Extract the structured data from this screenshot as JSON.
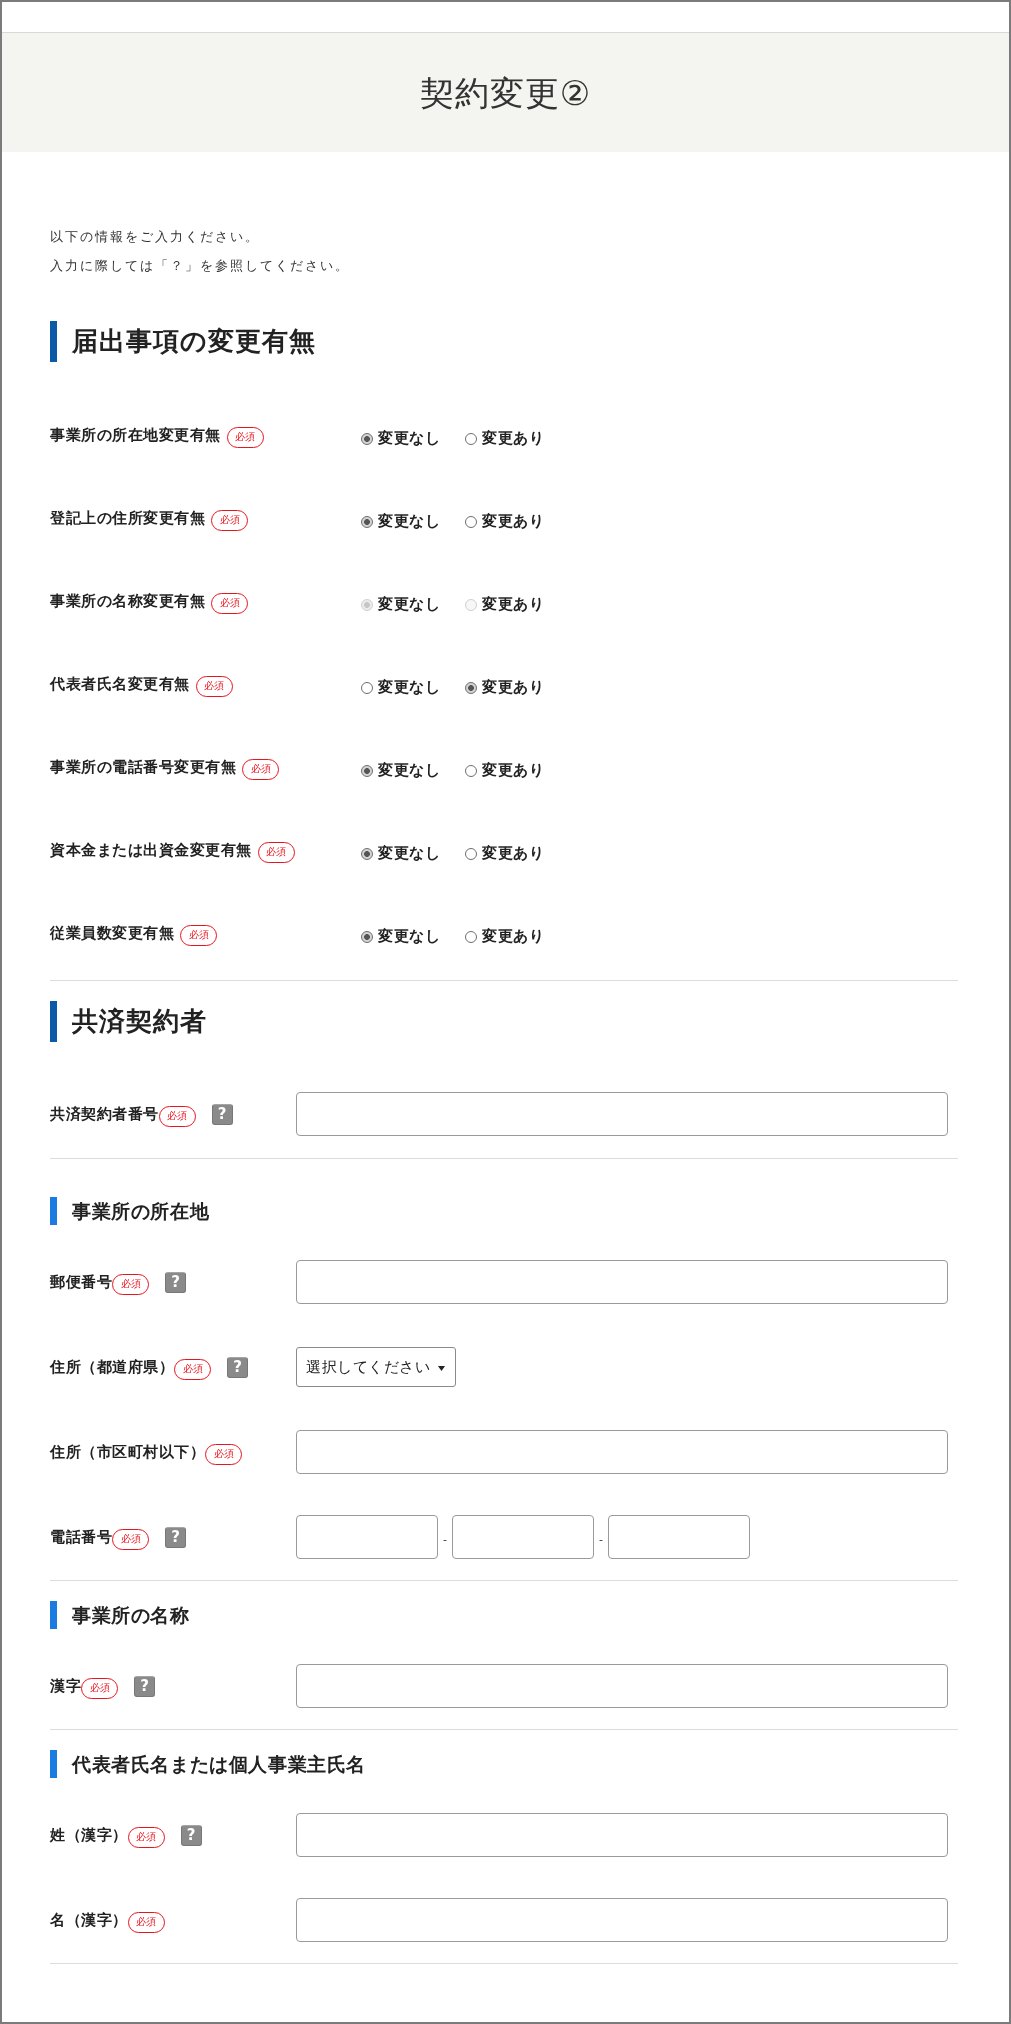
{
  "page": {
    "title": "契約変更②"
  },
  "intro": [
    "以下の情報をご入力ください。",
    "入力に際しては「？」を参照してください。"
  ],
  "sections": [
    {
      "heading": "届出事項の変更有無",
      "rows": [
        {
          "kind": "radio",
          "label": "事業所の所在地変更有無",
          "badge": "必須",
          "disabled": false,
          "options": [
            {
              "label": "変更なし",
              "selected": true
            },
            {
              "label": "変更あり",
              "selected": false
            }
          ]
        },
        {
          "kind": "radio",
          "label": "登記上の住所変更有無",
          "badge": "必須",
          "disabled": false,
          "options": [
            {
              "label": "変更なし",
              "selected": true
            },
            {
              "label": "変更あり",
              "selected": false
            }
          ]
        },
        {
          "kind": "radio",
          "label": "事業所の名称変更有無",
          "badge": "必須",
          "disabled": true,
          "options": [
            {
              "label": "変更なし",
              "selected": true
            },
            {
              "label": "変更あり",
              "selected": false
            }
          ]
        },
        {
          "kind": "radio",
          "label": "代表者氏名変更有無",
          "badge": "必須",
          "disabled": false,
          "options": [
            {
              "label": "変更なし",
              "selected": false
            },
            {
              "label": "変更あり",
              "selected": true
            }
          ]
        },
        {
          "kind": "radio",
          "label": "事業所の電話番号変更有無",
          "badge": "必須",
          "disabled": false,
          "options": [
            {
              "label": "変更なし",
              "selected": true
            },
            {
              "label": "変更あり",
              "selected": false
            }
          ]
        },
        {
          "kind": "radio",
          "label": "資本金または出資金変更有無",
          "badge": "必須",
          "disabled": false,
          "options": [
            {
              "label": "変更なし",
              "selected": true
            },
            {
              "label": "変更あり",
              "selected": false
            }
          ]
        },
        {
          "kind": "radio",
          "label": "従業員数変更有無",
          "badge": "必須",
          "disabled": false,
          "options": [
            {
              "label": "変更なし",
              "selected": true
            },
            {
              "label": "変更あり",
              "selected": false
            }
          ]
        }
      ]
    },
    {
      "heading": "共済契約者",
      "rows": [
        {
          "kind": "text",
          "label": "共済契約者番号",
          "badge": "必須",
          "help": "?"
        }
      ],
      "subsections": [
        {
          "heading": "事業所の所在地",
          "rows": [
            {
              "kind": "text",
              "label": "郵便番号",
              "badge": "必須",
              "help": "?"
            },
            {
              "kind": "select",
              "label": "住所（都道府県）",
              "badge": "必須",
              "help": "?",
              "value": "選択してください"
            },
            {
              "kind": "text",
              "label": "住所（市区町村以下）",
              "badge": "必須"
            },
            {
              "kind": "phone",
              "label": "電話番号",
              "badge": "必須",
              "help": "?",
              "separators": [
                "-",
                "-"
              ]
            }
          ]
        },
        {
          "heading": "事業所の名称",
          "rows": [
            {
              "kind": "text",
              "label": "漢字",
              "badge": "必須",
              "help": "?"
            }
          ]
        },
        {
          "heading": "代表者氏名または個人事業主氏名",
          "rows": [
            {
              "kind": "text",
              "label": "姓（漢字）",
              "badge": "必須",
              "help": "?"
            },
            {
              "kind": "text",
              "label": "名（漢字）",
              "badge": "必須"
            }
          ]
        }
      ]
    }
  ]
}
